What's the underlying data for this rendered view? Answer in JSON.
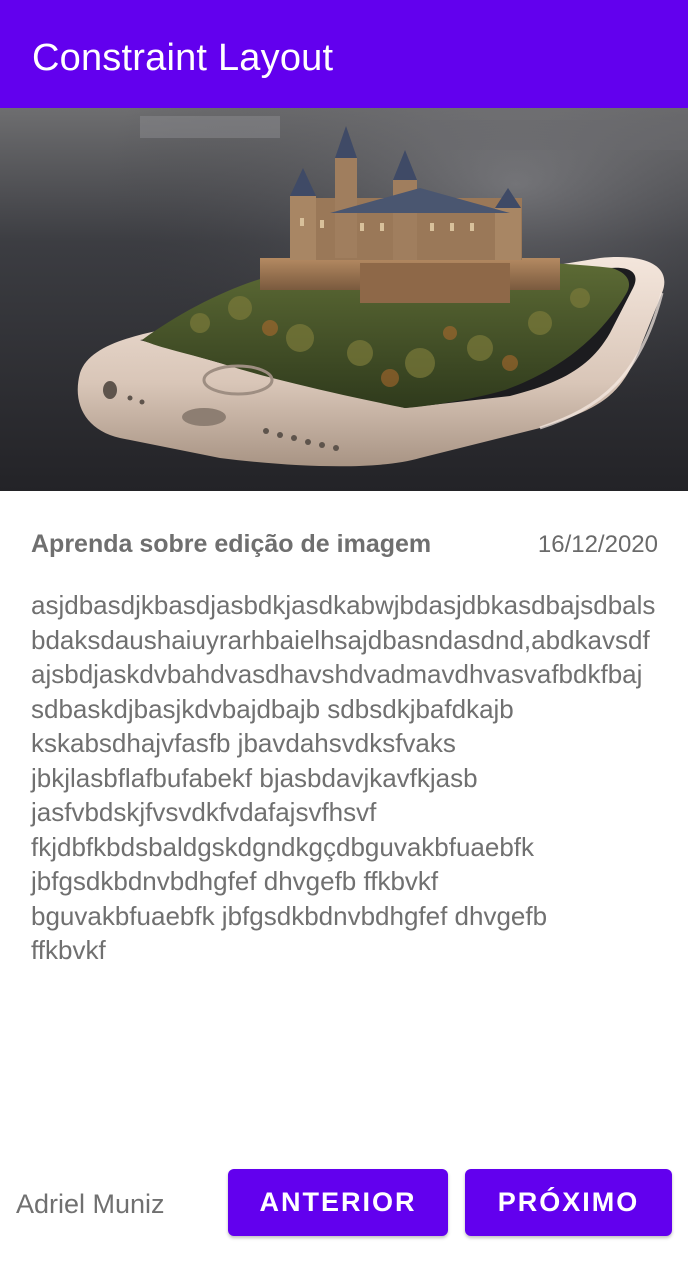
{
  "app_bar": {
    "title": "Constraint Layout",
    "color": "#6200ee"
  },
  "hero_image": {
    "description_icon": "phone-castle-image"
  },
  "article": {
    "headline": "Aprenda sobre edição de imagem",
    "date": "16/12/2020",
    "body": "asjdbasdjkbasdjasbdkjasdkabwjbdasjdbkasdbajsdbalsbdaksdaushaiuyrarhbaielhsajdbasndasdnd,abdkavsdfajsbdjaskdvbahdvasdhavshdvadmavdhvasvafbdkfbaj\nsdbaskdjbasjkdvbajdbajb sdbsdkjbafdkajb\nkskabsdhajvfasfb jbavdahsvdksfvaks\njbkjlasbflafbufabekf bjasbdavjkavfkjasb\njasfvbdskjfvsvdkfvdafajsvfhsvf\nfkjdbfkbdsbaldgskdgndkgçdbguvakbfuaebfk\njbfgsdkbdnvbdhgfef dhvgefb ffkbvkf\nbguvakbfuaebfk jbfgsdkbdnvbdhgfef dhvgefb\nffkbvkf"
  },
  "footer": {
    "author": "Adriel Muniz",
    "prev_label": "ANTERIOR",
    "next_label": "PRÓXIMO"
  }
}
